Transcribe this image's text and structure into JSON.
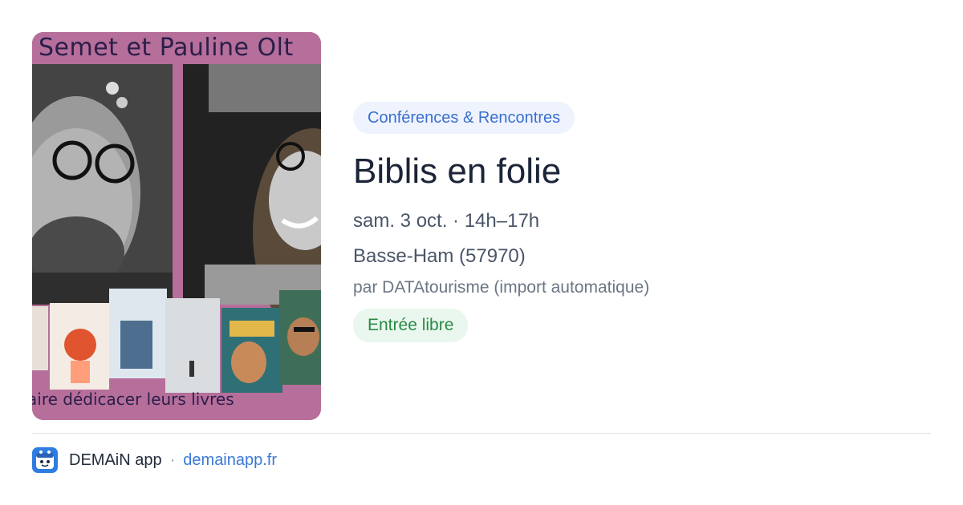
{
  "event": {
    "image_caption_top": "Semet et Pauline Olt",
    "image_caption_bottom": "aire dédicacer leurs livres",
    "category": "Conférences & Rencontres",
    "title": "Biblis en folie",
    "datetime": "sam. 3 oct. · 14h–17h",
    "location": "Basse-Ham (57970)",
    "source": "par DATAtourisme (import automatique)",
    "price": "Entrée libre"
  },
  "footer": {
    "app_icon": "demain-app-icon",
    "app_name": "DEMAiN app",
    "separator": "·",
    "site": "demainapp.fr"
  },
  "colors": {
    "image_background": "#b66e9a",
    "category_bg": "#eef3fd",
    "category_text": "#3a6fcf",
    "price_bg": "#eaf7ee",
    "price_text": "#2a8a45",
    "link": "#3a79d6"
  }
}
